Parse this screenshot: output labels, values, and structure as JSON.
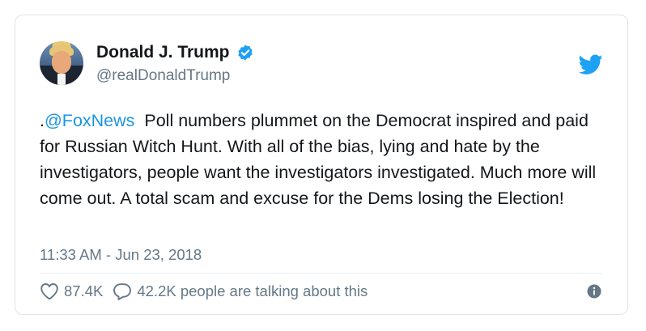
{
  "user": {
    "display_name": "Donald J. Trump",
    "handle": "@realDonaldTrump",
    "verified": true
  },
  "tweet": {
    "prefix": ".",
    "mention": "@FoxNews",
    "body": "  Poll numbers plummet on the Democrat inspired and paid for Russian Witch Hunt. With all of the bias, lying and hate by the investigators, people want the investigators investigated. Much more will come out. A total scam and excuse for the Dems losing the Election!",
    "timestamp": "11:33 AM - Jun 23, 2018"
  },
  "actions": {
    "likes": "87.4K",
    "talking": "42.2K people are talking about this"
  },
  "icons": {
    "brand": "twitter-bird-icon",
    "verified": "verified-badge-icon",
    "like": "heart-icon",
    "reply": "reply-bubble-icon",
    "info": "info-icon"
  },
  "colors": {
    "accent": "#1da1f2",
    "mention": "#1b95e0",
    "muted": "#657786",
    "text": "#14171a"
  }
}
